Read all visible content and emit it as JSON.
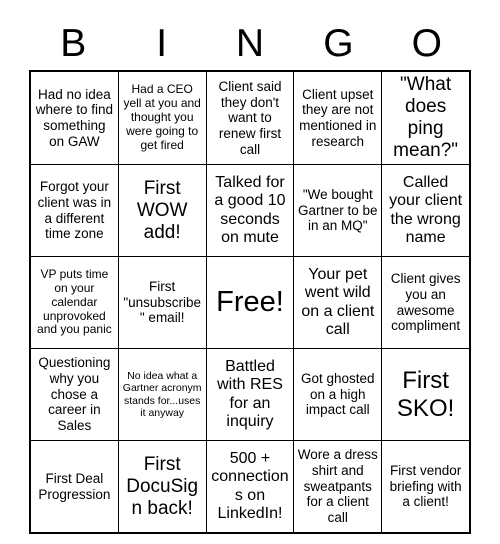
{
  "card": {
    "title": "BINGO",
    "header_letters": [
      "B",
      "I",
      "N",
      "G",
      "O"
    ],
    "rows": [
      [
        {
          "text": "Had no idea where to find something on GAW",
          "size": "fs-m"
        },
        {
          "text": "Had a CEO yell at you and thought you were going to get fired",
          "size": "fs-s"
        },
        {
          "text": "Client said they don't want to renew first call",
          "size": "fs-m"
        },
        {
          "text": "Client upset they are not mentioned in research",
          "size": "fs-m"
        },
        {
          "text": "\"What does ping mean?\"",
          "size": "fs-xl"
        }
      ],
      [
        {
          "text": "Forgot your client was in a different time zone",
          "size": "fs-m"
        },
        {
          "text": "First WOW add!",
          "size": "fs-xl"
        },
        {
          "text": "Talked for a good 10 seconds on mute",
          "size": "fs-l"
        },
        {
          "text": "\"We bought Gartner to be in an MQ\"",
          "size": "fs-m"
        },
        {
          "text": "Called your client the wrong name",
          "size": "fs-l"
        }
      ],
      [
        {
          "text": "VP puts time on your calendar unprovoked and you panic",
          "size": "fs-s"
        },
        {
          "text": "First \"unsubscribe\" email!",
          "size": "fs-m"
        },
        {
          "text": "Free!",
          "size": "fs-free"
        },
        {
          "text": "Your pet went wild on a client call",
          "size": "fs-l"
        },
        {
          "text": "Client gives you an awesome compliment",
          "size": "fs-m"
        }
      ],
      [
        {
          "text": "Questioning why you chose a career in Sales",
          "size": "fs-m"
        },
        {
          "text": "No idea what a Gartner acronym stands for...uses it anyway",
          "size": "fs-xs"
        },
        {
          "text": "Battled with RES for an inquiry",
          "size": "fs-l"
        },
        {
          "text": "Got ghosted on a high impact call",
          "size": "fs-m"
        },
        {
          "text": "First SKO!",
          "size": "fs-xxl"
        }
      ],
      [
        {
          "text": "First Deal Progression",
          "size": "fs-m"
        },
        {
          "text": "First DocuSign back!",
          "size": "fs-xl"
        },
        {
          "text": "500 + connections on LinkedIn!",
          "size": "fs-l"
        },
        {
          "text": "Wore a dress shirt and sweatpants for a client call",
          "size": "fs-m"
        },
        {
          "text": "First vendor briefing with a client!",
          "size": "fs-m"
        }
      ]
    ]
  }
}
